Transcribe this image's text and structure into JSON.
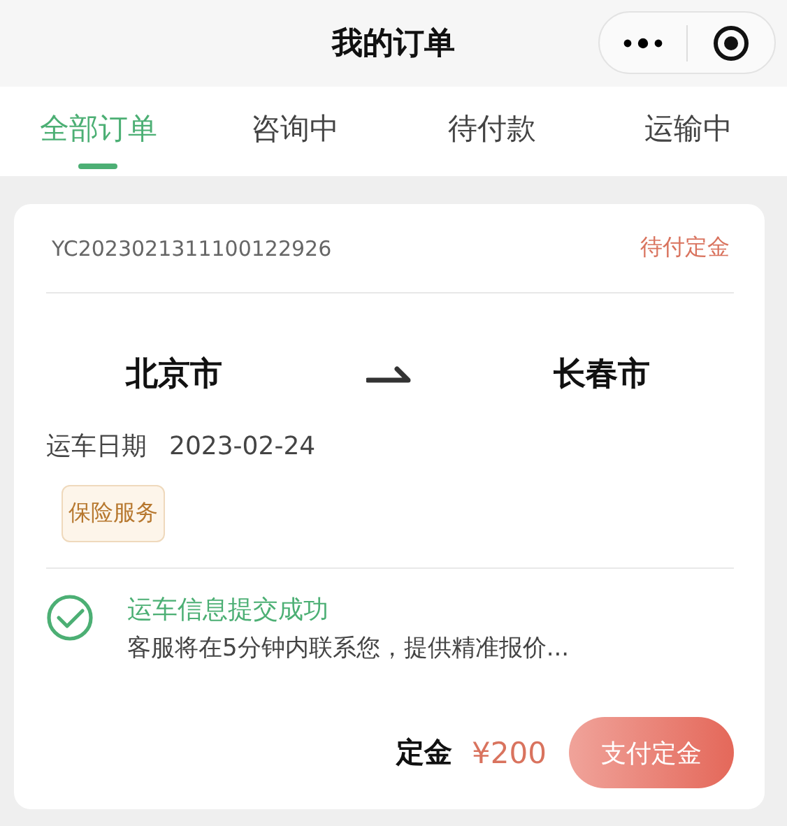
{
  "header": {
    "title": "我的订单"
  },
  "tabs": [
    {
      "label": "全部订单",
      "selected": true
    },
    {
      "label": "咨询中",
      "selected": false
    },
    {
      "label": "待付款",
      "selected": false
    },
    {
      "label": "运输中",
      "selected": false
    }
  ],
  "order": {
    "number": "YC2023021311100122926",
    "status": "待付定金",
    "from": "北京市",
    "to": "长春市",
    "date_label": "运车日期",
    "date": "2023-02-24",
    "tags": [
      "保险服务"
    ],
    "notice_title": "运车信息提交成功",
    "notice_text": "客服将在5分钟内联系您，提供精准报价...",
    "deposit_label": "定金",
    "deposit_amount": "¥200",
    "pay_button": "支付定金"
  }
}
